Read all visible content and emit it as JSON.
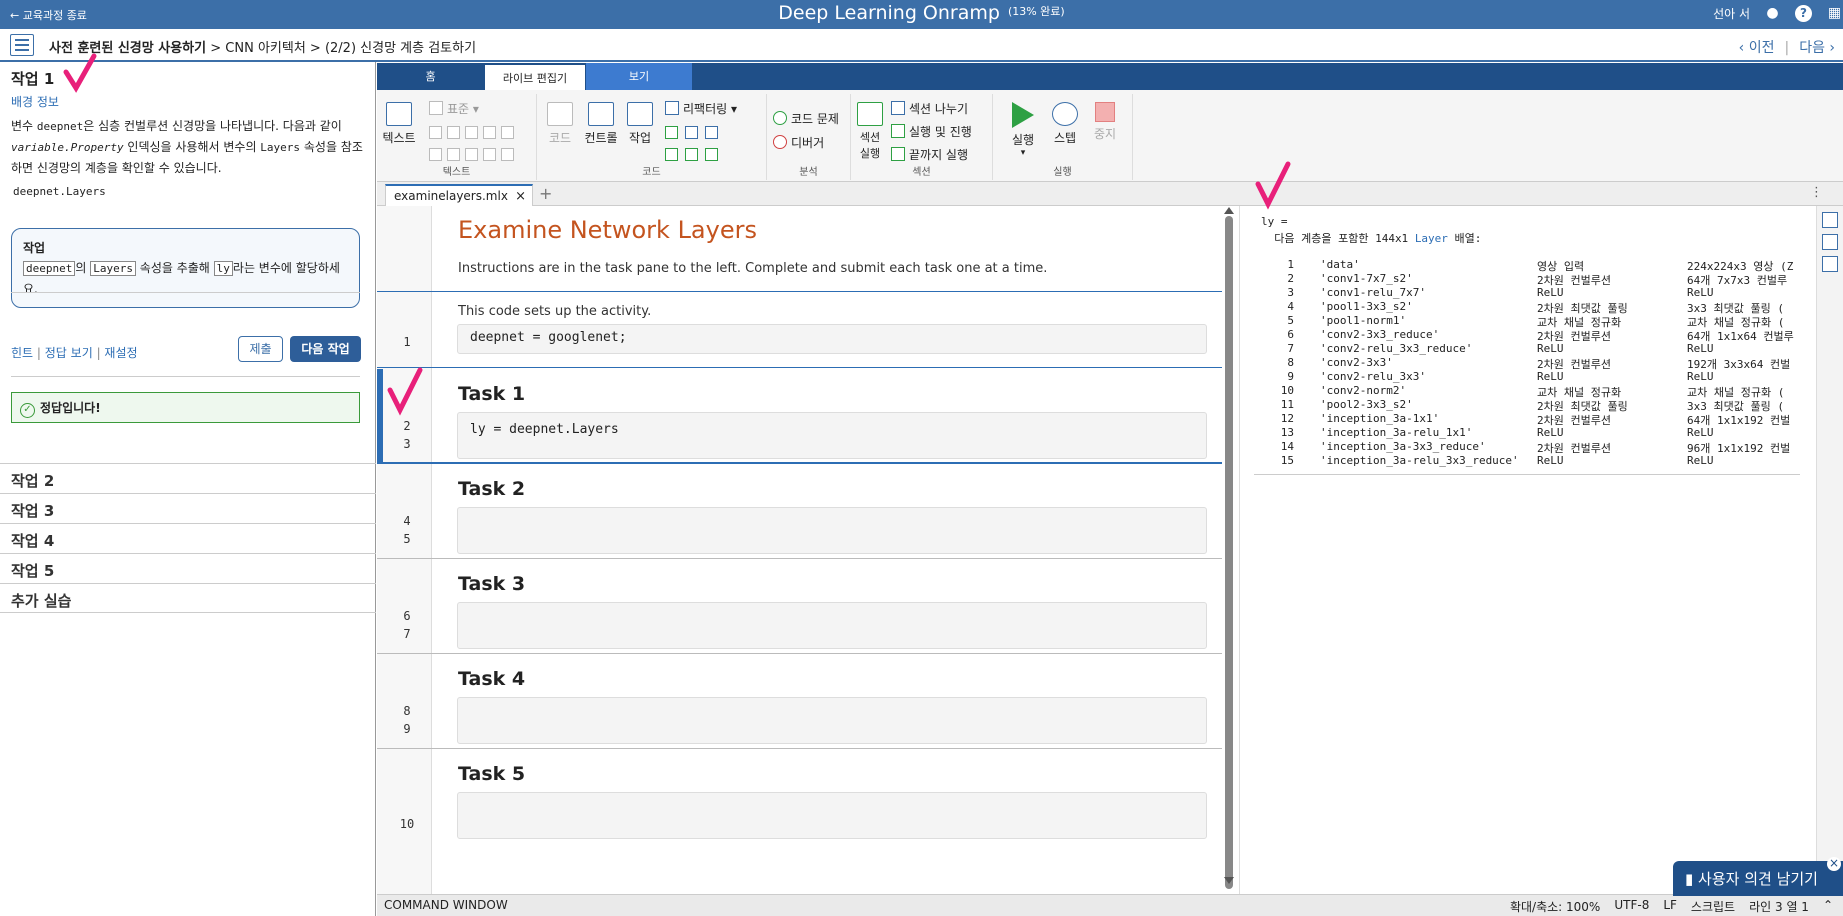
{
  "topbar": {
    "back": "← 교육과정 종료",
    "title": "Deep Learning Onramp",
    "progress": "(13% 완료)",
    "user": "선아 서"
  },
  "breadcrumb": {
    "part1": "사전 훈련된 신경망 사용하기",
    "sep1": " > ",
    "part2": "CNN 아키텍처",
    "sep2": " > ",
    "part3": "(2/2) 신경망 계층 검토하기",
    "prev": "‹ 이전",
    "next": "다음 ›"
  },
  "left": {
    "task_heading": "작업 1",
    "background_link": "배경 정보",
    "desc1": "변수 ",
    "desc_code1": "deepnet",
    "desc2": "은 심층 컨벌루션 신경망을 나타냅니다. 다음과 같이 ",
    "desc_code2": "variable.Property",
    "desc3": " 인덱싱을 사용해서 변수의 ",
    "desc_code3": "Layers",
    "desc4": " 속성을 참조하면 신경망의 계층을 확인할 수 있습니다.",
    "code": "deepnet.Layers",
    "task_box": {
      "title": "작업",
      "kw1": "deepnet",
      "t1": "의 ",
      "kw2": "Layers",
      "t2": " 속성을 추출해 ",
      "kw3": "ly",
      "t3": "라는 변수에 할당하세요."
    },
    "links": {
      "hint": "힌트",
      "answer": "정답 보기",
      "reset": "재설정",
      "sep": " | "
    },
    "submit": "제출",
    "next_task": "다음 작업",
    "correct": "정답입니다!",
    "tasks": [
      "작업 2",
      "작업 3",
      "작업 4",
      "작업 5",
      "추가 실습"
    ]
  },
  "tabs": {
    "home": "홈",
    "live": "라이브 편집기",
    "view": "보기"
  },
  "ribbon": {
    "text_btn": "텍스트",
    "font_style": "표준",
    "group_text": "텍스트",
    "code_btn": "코드",
    "controls": "컨트롤",
    "task": "작업",
    "refactor": "리팩터링",
    "group_code": "코드",
    "code_issues": "코드 문제",
    "debug": "디버거",
    "group_analysis": "분석",
    "section_run": "섹션 실행",
    "split": "섹션 나누기",
    "run_advance": "실행 및 진행",
    "run_to_end": "끝까지 실행",
    "group_section": "섹션",
    "run": "실행",
    "step": "스텝",
    "stop": "중지",
    "group_run": "실행"
  },
  "file_tab": "examinelayers.mlx",
  "editor": {
    "title": "Examine Network Layers",
    "intro": "Instructions are in the task pane to the left. Complete and submit each task one at a time.",
    "setup_text": "This code sets up the activity.",
    "setup_code": "deepnet = googlenet;",
    "sections": [
      {
        "title": "Task 1",
        "code": "ly = deepnet.Layers",
        "lines": [
          "2",
          "3"
        ]
      },
      {
        "title": "Task 2",
        "code": "",
        "lines": [
          "4",
          "5"
        ]
      },
      {
        "title": "Task 3",
        "code": "",
        "lines": [
          "6",
          "7"
        ]
      },
      {
        "title": "Task 4",
        "code": "",
        "lines": [
          "8",
          "9"
        ]
      },
      {
        "title": "Task 5",
        "code": "",
        "lines": [
          "10"
        ]
      }
    ],
    "line1": "1"
  },
  "output": {
    "var": "ly =",
    "desc_pre": "  다음 계층을 포함한 144x1 ",
    "desc_link": "Layer",
    "desc_post": " 배열:",
    "rows": [
      [
        "1",
        "'data'",
        "영상 입력",
        "224x224x3 영상 (Z"
      ],
      [
        "2",
        "'conv1-7x7_s2'",
        "2차원 컨벌루션",
        "64개 7x7x3 컨벌루"
      ],
      [
        "3",
        "'conv1-relu_7x7'",
        "ReLU",
        "ReLU"
      ],
      [
        "4",
        "'pool1-3x3_s2'",
        "2차원 최댓값 풀링",
        "3x3 최댓값 풀링 ("
      ],
      [
        "5",
        "'pool1-norm1'",
        "교차 채널 정규화",
        "교차 채널 정규화 ("
      ],
      [
        "6",
        "'conv2-3x3_reduce'",
        "2차원 컨벌루션",
        "64개 1x1x64 컨벌루"
      ],
      [
        "7",
        "'conv2-relu_3x3_reduce'",
        "ReLU",
        "ReLU"
      ],
      [
        "8",
        "'conv2-3x3'",
        "2차원 컨벌루션",
        "192개 3x3x64 컨벌"
      ],
      [
        "9",
        "'conv2-relu_3x3'",
        "ReLU",
        "ReLU"
      ],
      [
        "10",
        "'conv2-norm2'",
        "교차 채널 정규화",
        "교차 채널 정규화 ("
      ],
      [
        "11",
        "'pool2-3x3_s2'",
        "2차원 최댓값 풀링",
        "3x3 최댓값 풀링 ("
      ],
      [
        "12",
        "'inception_3a-1x1'",
        "2차원 컨벌루션",
        "64개 1x1x192 컨벌"
      ],
      [
        "13",
        "'inception_3a-relu_1x1'",
        "ReLU",
        "ReLU"
      ],
      [
        "14",
        "'inception_3a-3x3_reduce'",
        "2차원 컨벌루션",
        "96개 1x1x192 컨벌"
      ],
      [
        "15",
        "'inception_3a-relu_3x3_reduce'",
        "ReLU",
        "ReLU"
      ]
    ]
  },
  "status": {
    "cmd": "COMMAND WINDOW",
    "zoom": "확대/축소: 100%",
    "enc": "UTF-8",
    "eol": "LF",
    "type": "스크립트",
    "pos": "라인 3 열 1"
  },
  "feedback": "사용자 의견 남기기",
  "colors": {
    "brand": "#3c6fa8",
    "accent": "#c4541f",
    "mark": "#e8207a"
  }
}
